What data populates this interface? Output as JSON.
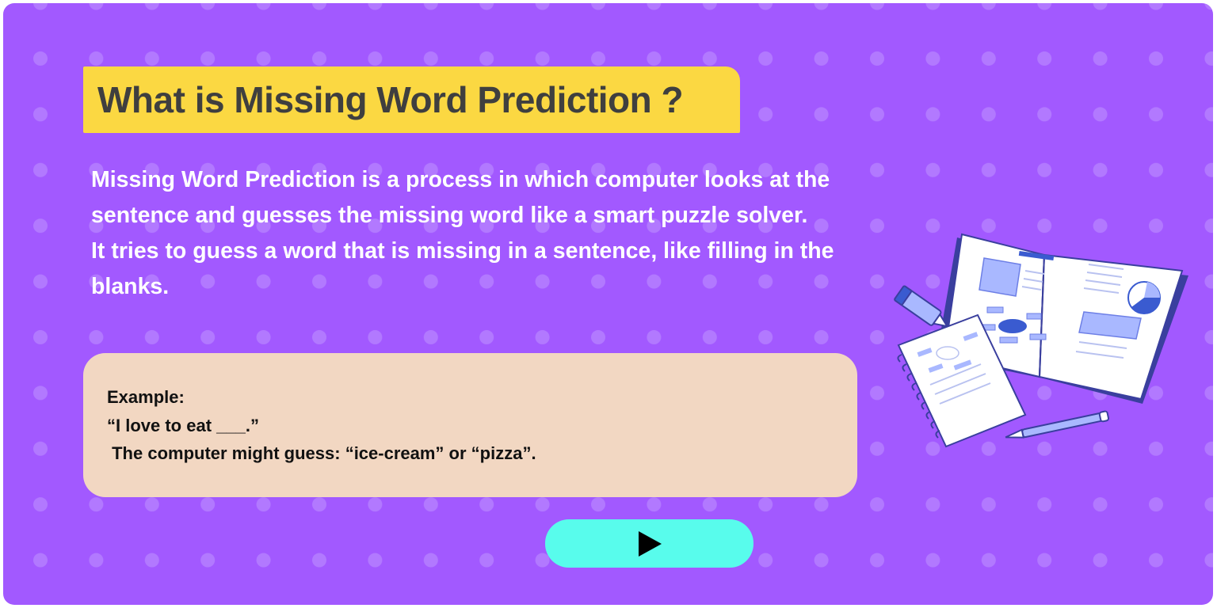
{
  "page": {
    "title": "What is Missing Word Prediction ?",
    "description_lines": [
      "Missing Word Prediction is a process in which computer looks at the",
      "sentence and guesses the missing word like a smart puzzle solver.",
      "It tries to guess a word that is missing in a sentence, like filling in the",
      "blanks."
    ]
  },
  "example": {
    "label": "Example:",
    "sentence": "“I love to eat ___.”",
    "guess": " The computer might guess: “ice-cream” or “pizza”."
  },
  "play_button": {
    "icon": "play-icon"
  },
  "illustration": {
    "icon": "book-notebook-illustration"
  },
  "colors": {
    "background": "#a259ff",
    "title_bg": "#fbd842",
    "example_bg": "#f2d7c2",
    "button_bg": "#58fcec",
    "dot": "#b279ff"
  }
}
